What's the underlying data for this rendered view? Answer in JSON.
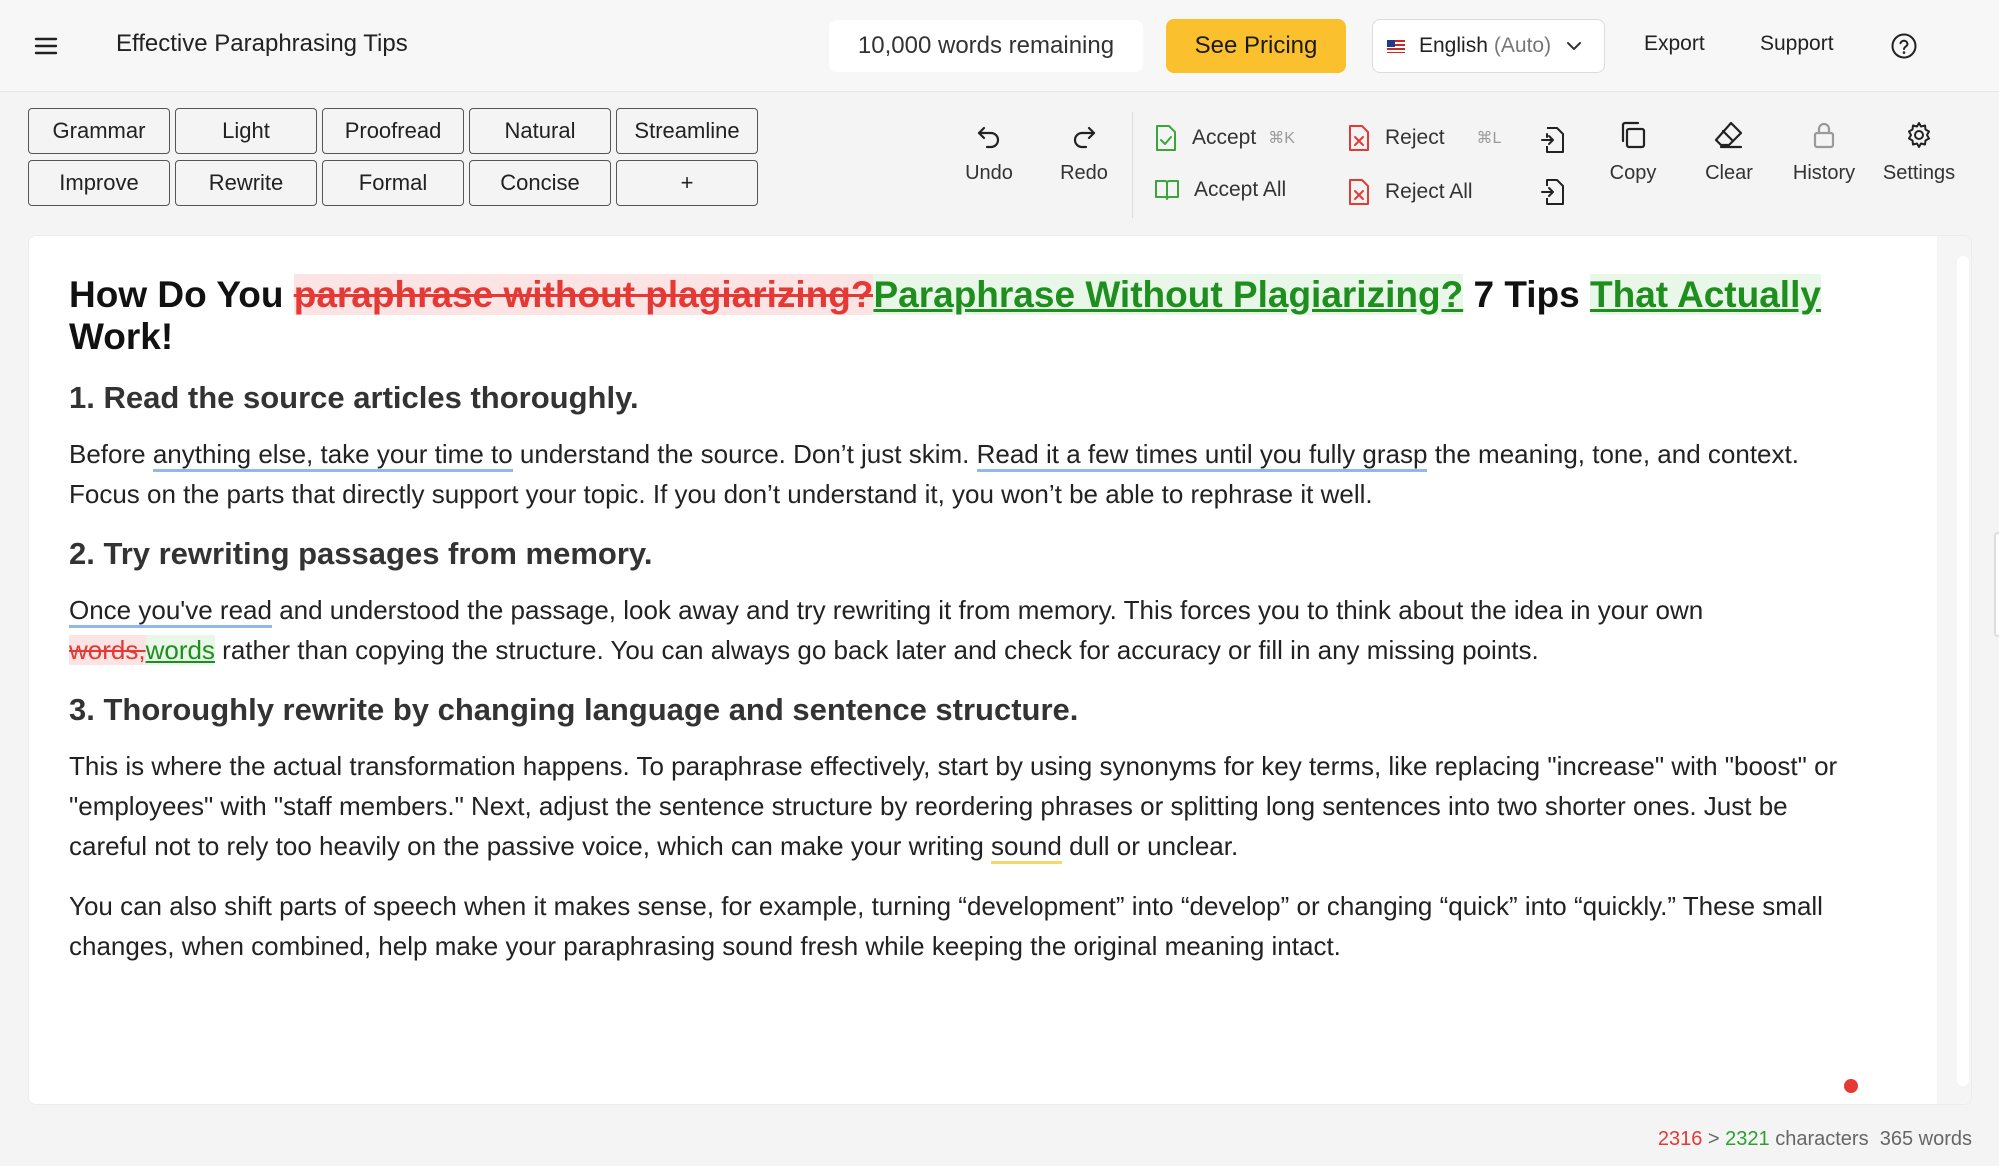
{
  "header": {
    "doc_title": "Effective Paraphrasing Tips",
    "words_remaining": "10,000 words remaining",
    "pricing_label": "See Pricing",
    "language": "English",
    "language_mode": "(Auto)",
    "export_label": "Export",
    "support_label": "Support",
    "accent_color": "#fbc02d"
  },
  "modes": {
    "grammar": "Grammar",
    "light": "Light",
    "proofread": "Proofread",
    "natural": "Natural",
    "streamline": "Streamline",
    "improve": "Improve",
    "rewrite": "Rewrite",
    "formal": "Formal",
    "concise": "Concise",
    "add": "+"
  },
  "tools": {
    "undo": "Undo",
    "redo": "Redo",
    "accept": "Accept",
    "accept_shortcut": "⌘K",
    "accept_all": "Accept All",
    "reject": "Reject",
    "reject_shortcut": "⌘L",
    "reject_all": "Reject All",
    "copy": "Copy",
    "clear": "Clear",
    "history": "History",
    "settings": "Settings"
  },
  "document": {
    "title_prefix": "How Do You ",
    "title_deleted": "paraphrase without plagiarizing?",
    "title_inserted": "Paraphrase Without Plagiarizing?",
    "title_mid": " 7 Tips ",
    "title_inserted2": "That Actually",
    "title_suffix": " Work!",
    "h1": "1. Read the source articles thoroughly.",
    "p1_a": "Before ",
    "p1_b": "anything else, take your time to",
    "p1_c": " understand the source. Don’t just skim. ",
    "p1_d": "Read it a few times until you fully grasp",
    "p1_e": " the meaning, tone, and context. Focus on the parts that directly support your topic. If you don’t understand it, you won’t be able to rephrase it well.",
    "h2": "2. Try rewriting passages from memory.",
    "p2_a": "Once you've read",
    "p2_b": " and understood the passage, look away and try rewriting it from memory. This forces you to think about the idea in your own ",
    "p2_del": "words,",
    "p2_ins": "words",
    "p2_c": " rather than copying the structure. You can always go back later and check for accuracy or fill in any missing points.",
    "h3": "3. Thoroughly rewrite by changing language and sentence structure.",
    "p3_a": "This is where the actual transformation happens. To paraphrase effectively, start by using synonyms for key terms, like replacing \"increase\" with \"boost\" or \"employees\" with \"staff members.\" Next, adjust the sentence structure by reordering phrases or splitting long sentences into two shorter ones. Just be careful not to rely too heavily on the passive voice, which can make your writing ",
    "p3_b": "sound",
    "p3_c": " dull or unclear.",
    "p4": "You can also shift parts of speech when it makes sense, for example, turning “development” into “develop” or changing “quick” into “quickly.” These small changes, when combined, help make your paraphrasing sound fresh while keeping the original meaning intact."
  },
  "footer": {
    "old_chars": "2316",
    "separator": " > ",
    "new_chars": "2321",
    "chars_label": " characters",
    "words": "365 words"
  }
}
